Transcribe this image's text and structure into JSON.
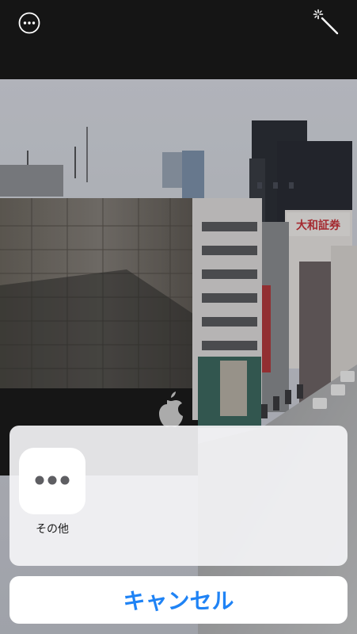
{
  "top_bar": {
    "more_icon": "ellipsis-circle-icon",
    "edit_icon": "magic-wand-icon"
  },
  "photo": {
    "sign_text": "大和証券"
  },
  "share_sheet": {
    "options": [
      {
        "label": "その他",
        "icon": "more-dots-icon"
      }
    ]
  },
  "cancel": {
    "label": "キャンセル"
  },
  "colors": {
    "accent": "#1f83f5",
    "sheet_bg": "#f4f4f6"
  }
}
